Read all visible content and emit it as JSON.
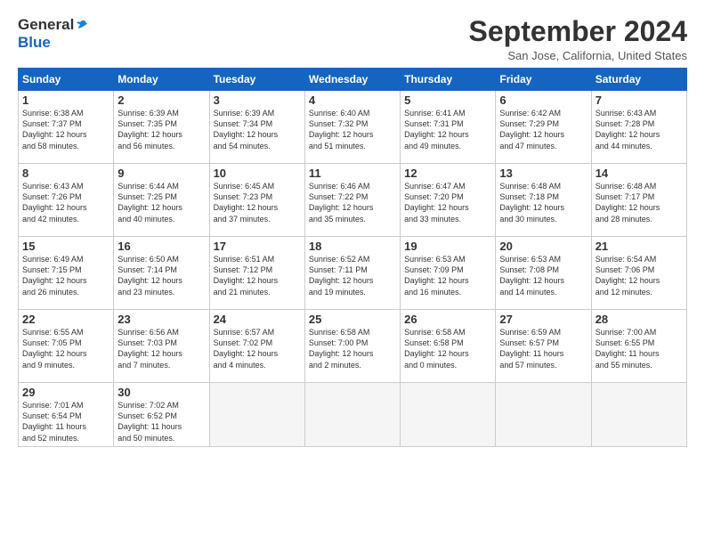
{
  "logo": {
    "general": "General",
    "blue": "Blue"
  },
  "title": "September 2024",
  "location": "San Jose, California, United States",
  "weekdays": [
    "Sunday",
    "Monday",
    "Tuesday",
    "Wednesday",
    "Thursday",
    "Friday",
    "Saturday"
  ],
  "weeks": [
    [
      {
        "day": "1",
        "info": "Sunrise: 6:38 AM\nSunset: 7:37 PM\nDaylight: 12 hours\nand 58 minutes."
      },
      {
        "day": "2",
        "info": "Sunrise: 6:39 AM\nSunset: 7:35 PM\nDaylight: 12 hours\nand 56 minutes."
      },
      {
        "day": "3",
        "info": "Sunrise: 6:39 AM\nSunset: 7:34 PM\nDaylight: 12 hours\nand 54 minutes."
      },
      {
        "day": "4",
        "info": "Sunrise: 6:40 AM\nSunset: 7:32 PM\nDaylight: 12 hours\nand 51 minutes."
      },
      {
        "day": "5",
        "info": "Sunrise: 6:41 AM\nSunset: 7:31 PM\nDaylight: 12 hours\nand 49 minutes."
      },
      {
        "day": "6",
        "info": "Sunrise: 6:42 AM\nSunset: 7:29 PM\nDaylight: 12 hours\nand 47 minutes."
      },
      {
        "day": "7",
        "info": "Sunrise: 6:43 AM\nSunset: 7:28 PM\nDaylight: 12 hours\nand 44 minutes."
      }
    ],
    [
      {
        "day": "8",
        "info": "Sunrise: 6:43 AM\nSunset: 7:26 PM\nDaylight: 12 hours\nand 42 minutes."
      },
      {
        "day": "9",
        "info": "Sunrise: 6:44 AM\nSunset: 7:25 PM\nDaylight: 12 hours\nand 40 minutes."
      },
      {
        "day": "10",
        "info": "Sunrise: 6:45 AM\nSunset: 7:23 PM\nDaylight: 12 hours\nand 37 minutes."
      },
      {
        "day": "11",
        "info": "Sunrise: 6:46 AM\nSunset: 7:22 PM\nDaylight: 12 hours\nand 35 minutes."
      },
      {
        "day": "12",
        "info": "Sunrise: 6:47 AM\nSunset: 7:20 PM\nDaylight: 12 hours\nand 33 minutes."
      },
      {
        "day": "13",
        "info": "Sunrise: 6:48 AM\nSunset: 7:18 PM\nDaylight: 12 hours\nand 30 minutes."
      },
      {
        "day": "14",
        "info": "Sunrise: 6:48 AM\nSunset: 7:17 PM\nDaylight: 12 hours\nand 28 minutes."
      }
    ],
    [
      {
        "day": "15",
        "info": "Sunrise: 6:49 AM\nSunset: 7:15 PM\nDaylight: 12 hours\nand 26 minutes."
      },
      {
        "day": "16",
        "info": "Sunrise: 6:50 AM\nSunset: 7:14 PM\nDaylight: 12 hours\nand 23 minutes."
      },
      {
        "day": "17",
        "info": "Sunrise: 6:51 AM\nSunset: 7:12 PM\nDaylight: 12 hours\nand 21 minutes."
      },
      {
        "day": "18",
        "info": "Sunrise: 6:52 AM\nSunset: 7:11 PM\nDaylight: 12 hours\nand 19 minutes."
      },
      {
        "day": "19",
        "info": "Sunrise: 6:53 AM\nSunset: 7:09 PM\nDaylight: 12 hours\nand 16 minutes."
      },
      {
        "day": "20",
        "info": "Sunrise: 6:53 AM\nSunset: 7:08 PM\nDaylight: 12 hours\nand 14 minutes."
      },
      {
        "day": "21",
        "info": "Sunrise: 6:54 AM\nSunset: 7:06 PM\nDaylight: 12 hours\nand 12 minutes."
      }
    ],
    [
      {
        "day": "22",
        "info": "Sunrise: 6:55 AM\nSunset: 7:05 PM\nDaylight: 12 hours\nand 9 minutes."
      },
      {
        "day": "23",
        "info": "Sunrise: 6:56 AM\nSunset: 7:03 PM\nDaylight: 12 hours\nand 7 minutes."
      },
      {
        "day": "24",
        "info": "Sunrise: 6:57 AM\nSunset: 7:02 PM\nDaylight: 12 hours\nand 4 minutes."
      },
      {
        "day": "25",
        "info": "Sunrise: 6:58 AM\nSunset: 7:00 PM\nDaylight: 12 hours\nand 2 minutes."
      },
      {
        "day": "26",
        "info": "Sunrise: 6:58 AM\nSunset: 6:58 PM\nDaylight: 12 hours\nand 0 minutes."
      },
      {
        "day": "27",
        "info": "Sunrise: 6:59 AM\nSunset: 6:57 PM\nDaylight: 11 hours\nand 57 minutes."
      },
      {
        "day": "28",
        "info": "Sunrise: 7:00 AM\nSunset: 6:55 PM\nDaylight: 11 hours\nand 55 minutes."
      }
    ],
    [
      {
        "day": "29",
        "info": "Sunrise: 7:01 AM\nSunset: 6:54 PM\nDaylight: 11 hours\nand 52 minutes."
      },
      {
        "day": "30",
        "info": "Sunrise: 7:02 AM\nSunset: 6:52 PM\nDaylight: 11 hours\nand 50 minutes."
      },
      {
        "day": "",
        "info": ""
      },
      {
        "day": "",
        "info": ""
      },
      {
        "day": "",
        "info": ""
      },
      {
        "day": "",
        "info": ""
      },
      {
        "day": "",
        "info": ""
      }
    ]
  ]
}
